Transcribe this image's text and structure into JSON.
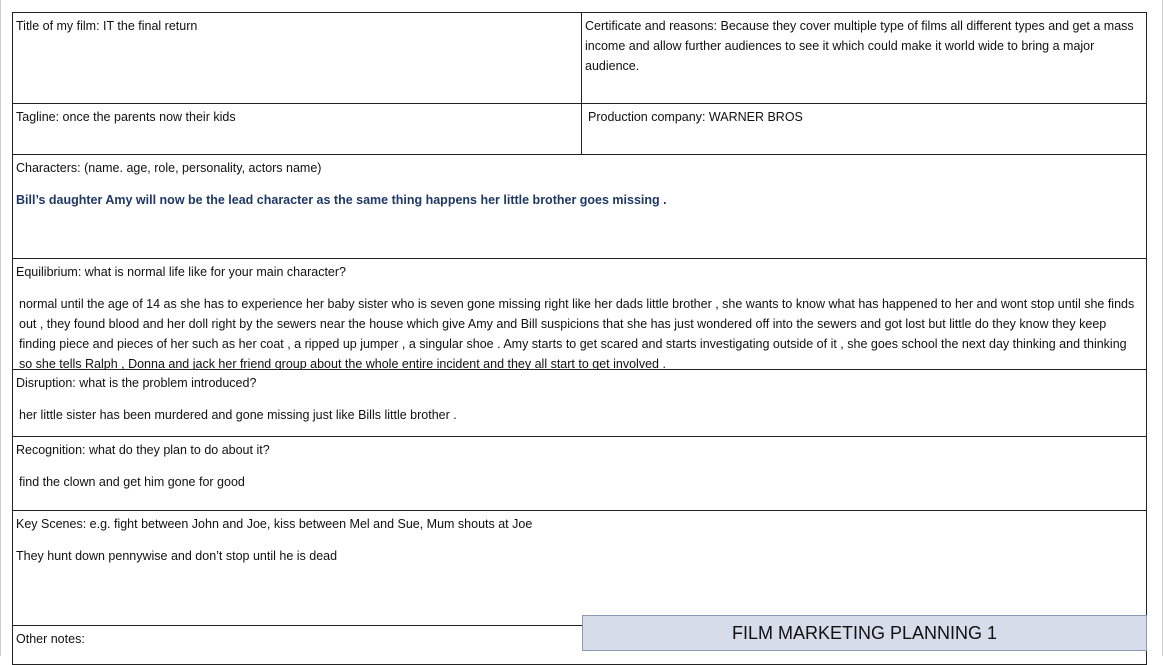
{
  "title_cell": "Title of my film: IT the final return",
  "certificate_cell": "Certificate and reasons: Because they cover multiple type of films all different types and get a mass income and allow further audiences to see it which could make it world wide to bring a major audience.",
  "tagline_cell": "Tagline: once the parents now their kids",
  "production_cell": "Production company: WARNER BROS",
  "characters": {
    "label": "Characters: (name. age, role, personality, actors name)",
    "answer": "Bill’s daughter Amy will now be the lead character as the same thing happens her little brother goes missing ."
  },
  "equilibrium": {
    "label": "Equilibrium: what is normal life like for your main character?",
    "answer": "normal until the age of 14 as she has to experience her baby sister who is seven gone missing right like her dads little brother , she wants to know what has happened to her and wont stop until she finds out , they found blood and her doll right by the sewers near the house which give Amy and Bill suspicions that she has just wondered off into the sewers and got lost but little do they know they keep finding piece and pieces of her such as her coat , a ripped up jumper , a singular shoe . Amy starts to get scared and starts investigating outside of it , she goes school the next day thinking and thinking so she tells Ralph , Donna and jack her friend group about the whole entire incident and they all start to get involved ."
  },
  "disruption": {
    "label": "Disruption: what is the problem introduced?",
    "answer": "her little sister has been murdered and gone missing just like Bills little brother ."
  },
  "recognition": {
    "label": "Recognition: what do they plan to do about it?",
    "answer": "find the clown and get him gone for good"
  },
  "key_scenes": {
    "label": "Key Scenes: e.g. fight between John and Joe, kiss between Mel and Sue, Mum shouts at Joe",
    "answer": "They hunt down pennywise and don’t stop until he is dead"
  },
  "other_notes": {
    "label": "Other notes:"
  },
  "banner": "FILM MARKETING PLANNING 1"
}
